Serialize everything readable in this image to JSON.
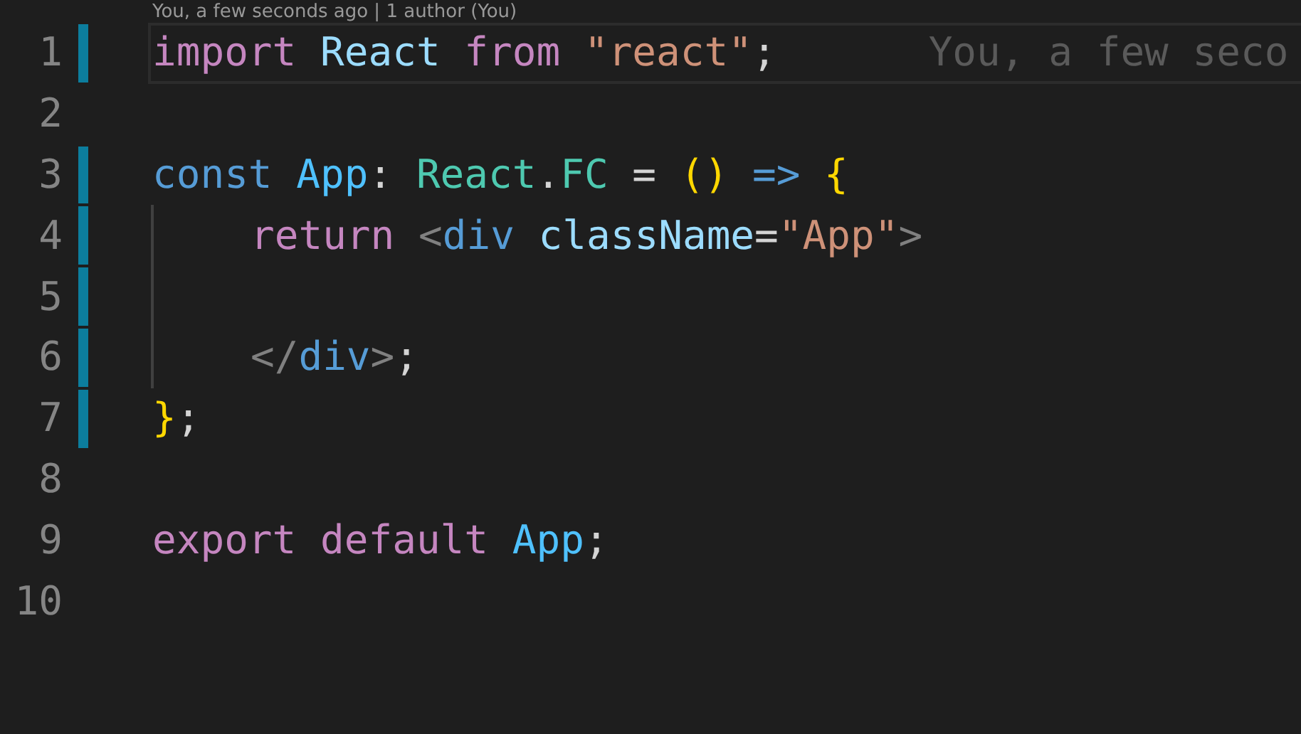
{
  "codelens": "You, a few seconds ago | 1 author (You)",
  "lines": [
    {
      "number": "1",
      "modified": true,
      "current": true,
      "indented": false,
      "tokens": [
        {
          "kind": "keyword",
          "text": "import"
        },
        {
          "kind": "variable",
          "text": " React"
        },
        {
          "kind": "keyword",
          "text": " from"
        },
        {
          "kind": "string",
          "text": " \"react\""
        },
        {
          "kind": "plain",
          "text": ";"
        }
      ],
      "blame": "You, a few seco"
    },
    {
      "number": "2",
      "modified": false,
      "current": false,
      "indented": false
    },
    {
      "number": "3",
      "modified": true,
      "current": false,
      "indented": false,
      "tokens": [
        {
          "kind": "storage",
          "text": "const"
        },
        {
          "kind": "constant",
          "text": " App"
        },
        {
          "kind": "plain",
          "text": ":"
        },
        {
          "kind": "type",
          "text": " React"
        },
        {
          "kind": "plain",
          "text": "."
        },
        {
          "kind": "type",
          "text": "FC"
        },
        {
          "kind": "plain",
          "text": " ="
        },
        {
          "kind": "bracket",
          "text": " ()"
        },
        {
          "kind": "storage",
          "text": " =>"
        },
        {
          "kind": "bracket",
          "text": " {"
        }
      ]
    },
    {
      "number": "4",
      "modified": true,
      "current": false,
      "indented": true,
      "tokens": [
        {
          "kind": "keyword",
          "text": "return"
        },
        {
          "kind": "tagpunct",
          "text": " <"
        },
        {
          "kind": "storage",
          "text": "div"
        },
        {
          "kind": "variable",
          "text": " className"
        },
        {
          "kind": "plain",
          "text": "="
        },
        {
          "kind": "string",
          "text": "\"App\""
        },
        {
          "kind": "tagpunct",
          "text": ">"
        }
      ]
    },
    {
      "number": "5",
      "modified": true,
      "current": false,
      "indented": true
    },
    {
      "number": "6",
      "modified": true,
      "current": false,
      "indented": true,
      "tokens": [
        {
          "kind": "tagpunct",
          "text": "</"
        },
        {
          "kind": "storage",
          "text": "div"
        },
        {
          "kind": "tagpunct",
          "text": ">"
        },
        {
          "kind": "plain",
          "text": ";"
        }
      ]
    },
    {
      "number": "7",
      "modified": true,
      "current": false,
      "indented": false,
      "tokens": [
        {
          "kind": "bracket",
          "text": "}"
        },
        {
          "kind": "plain",
          "text": ";"
        }
      ]
    },
    {
      "number": "8",
      "modified": false,
      "current": false,
      "indented": false
    },
    {
      "number": "9",
      "modified": false,
      "current": false,
      "indented": false,
      "tokens": [
        {
          "kind": "keyword",
          "text": "export"
        },
        {
          "kind": "keyword",
          "text": " default"
        },
        {
          "kind": "constant",
          "text": " App"
        },
        {
          "kind": "plain",
          "text": ";"
        }
      ]
    },
    {
      "number": "10",
      "modified": false,
      "current": false,
      "indented": false
    }
  ]
}
